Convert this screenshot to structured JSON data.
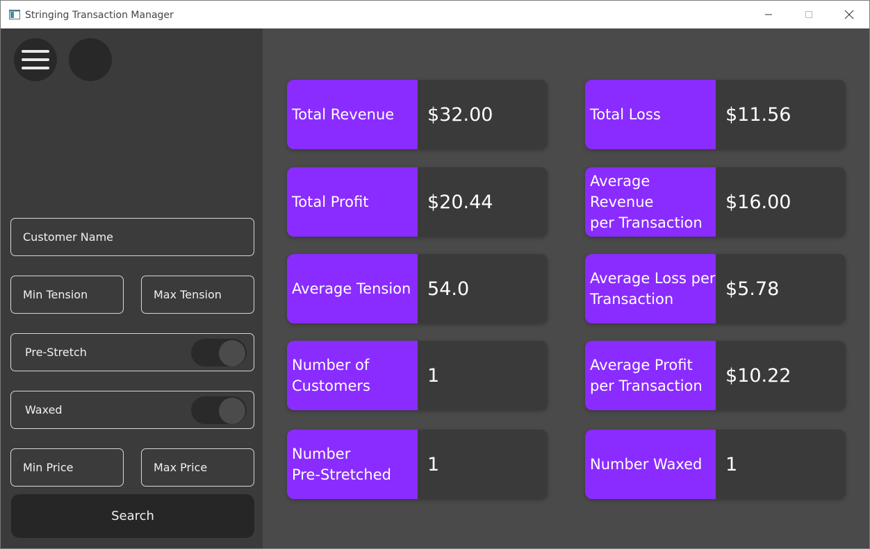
{
  "window": {
    "title": "Stringing Transaction Manager"
  },
  "colors": {
    "accent": "#8a2cff",
    "sidebar": "#3b3b3b",
    "main": "#4a4a4a",
    "card_value_bg": "#3a3a3a"
  },
  "sidebar": {
    "menu_icon": "hamburger-icon",
    "customer_name_placeholder": "Customer Name",
    "min_tension_placeholder": "Min Tension",
    "max_tension_placeholder": "Max Tension",
    "pre_stretch_label": "Pre-Stretch",
    "waxed_label": "Waxed",
    "min_price_placeholder": "Min Price",
    "max_price_placeholder": "Max Price",
    "search_label": "Search"
  },
  "stats": [
    {
      "label": "Total Revenue",
      "value": "$32.00"
    },
    {
      "label": "Total Loss",
      "value": "$11.56"
    },
    {
      "label": "Total Profit",
      "value": "$20.44"
    },
    {
      "label": "Average Revenue\nper Transaction",
      "value": "$16.00"
    },
    {
      "label": "Average Tension",
      "value": "54.0"
    },
    {
      "label": "Average Loss per\nTransaction",
      "value": "$5.78"
    },
    {
      "label": "Number of\nCustomers",
      "value": "1"
    },
    {
      "label": "Average Profit\nper Transaction",
      "value": "$10.22"
    },
    {
      "label": "Number\nPre-Stretched",
      "value": "1"
    },
    {
      "label": "Number Waxed",
      "value": "1"
    }
  ]
}
